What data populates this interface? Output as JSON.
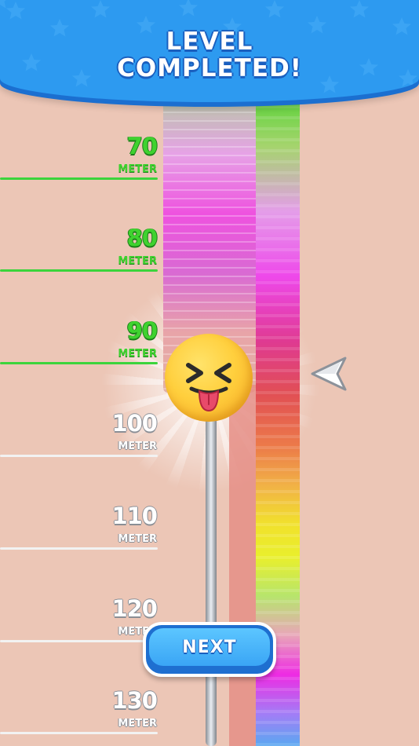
{
  "header": {
    "title_line1": "LEVEL",
    "title_line2": "COMPLETED!"
  },
  "meters": {
    "unit": "METER",
    "markers": [
      {
        "value": "70",
        "state": "passed"
      },
      {
        "value": "80",
        "state": "passed"
      },
      {
        "value": "90",
        "state": "passed"
      },
      {
        "value": "100",
        "state": "not-reached"
      },
      {
        "value": "110",
        "state": "not-reached"
      },
      {
        "value": "120",
        "state": "not-reached"
      },
      {
        "value": "130",
        "state": "not-reached"
      }
    ]
  },
  "character": {
    "icon": "tongue-out-squinting-face-icon"
  },
  "pointer": {
    "icon": "left-arrow-pointer-icon"
  },
  "next_button": {
    "label": "NEXT"
  },
  "colors": {
    "header_blue": "#2d9af0",
    "passed_green": "#3fd22f",
    "button_blue": "#3aa5f5",
    "background": "#ecc6b6"
  }
}
